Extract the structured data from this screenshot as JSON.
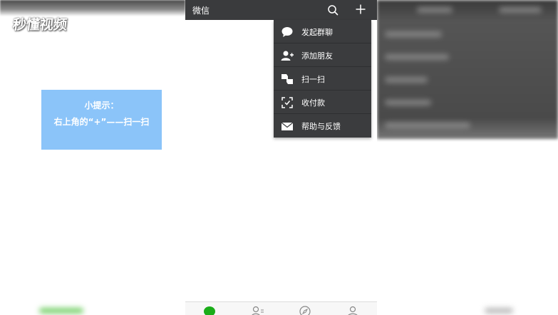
{
  "watermark": {
    "text": "秒懂视频"
  },
  "tip": {
    "title": "小提示：",
    "text": "右上角的“+”——扫一扫"
  },
  "app": {
    "title": "微信",
    "menu": [
      {
        "label": "发起群聊",
        "icon": "chat-bubble-icon"
      },
      {
        "label": "添加朋友",
        "icon": "add-friend-icon"
      },
      {
        "label": "扫一扫",
        "icon": "scan-icon"
      },
      {
        "label": "收付款",
        "icon": "payment-icon"
      },
      {
        "label": "帮助与反馈",
        "icon": "mail-icon"
      }
    ],
    "tabs": [
      {
        "name": "chats",
        "icon": "chats-icon"
      },
      {
        "name": "contacts",
        "icon": "contacts-icon"
      },
      {
        "name": "discover",
        "icon": "compass-icon"
      },
      {
        "name": "me",
        "icon": "person-icon"
      }
    ]
  },
  "colors": {
    "topbar": "#3a3b3d",
    "menu": "#3b3c3e",
    "tip_box": "#8bc4f9",
    "accent": "#1aad19"
  }
}
